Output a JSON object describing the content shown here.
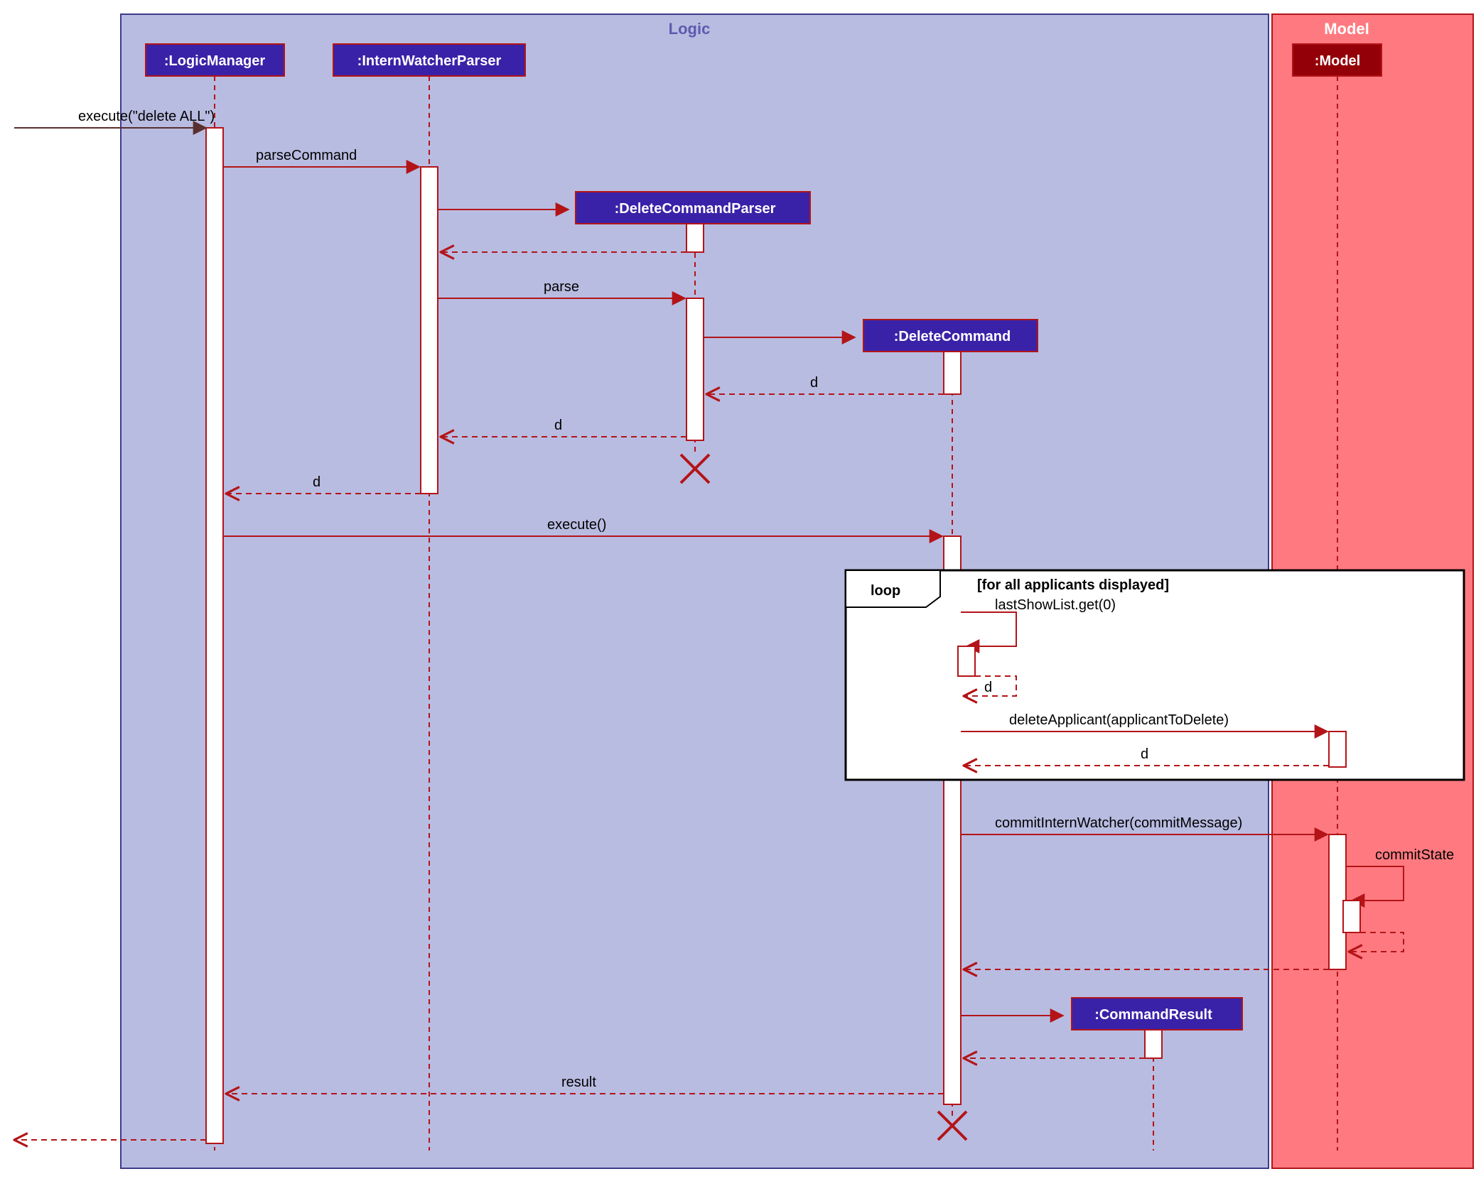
{
  "packages": {
    "logic": "Logic",
    "model": "Model"
  },
  "participants": {
    "logicManager": ":LogicManager",
    "internWatcherParser": ":InternWatcherParser",
    "deleteCommandParser": ":DeleteCommandParser",
    "deleteCommand": ":DeleteCommand",
    "commandResult": ":CommandResult",
    "model": ":Model"
  },
  "messages": {
    "entry": "execute(\"delete ALL\")",
    "parseCommand": "parseCommand",
    "parse": "parse",
    "d1": "d",
    "d2": "d",
    "d3": "d",
    "d4": "d",
    "d5": "d",
    "execute": "execute()",
    "lastShowList": "lastShowList.get(0)",
    "deleteApplicant": "deleteApplicant(applicantToDelete)",
    "commitInternWatcher": "commitInternWatcher(commitMessage)",
    "commitState": "commitState",
    "result": "result"
  },
  "fragment": {
    "type": "loop",
    "guard": "[for all applicants displayed]"
  }
}
